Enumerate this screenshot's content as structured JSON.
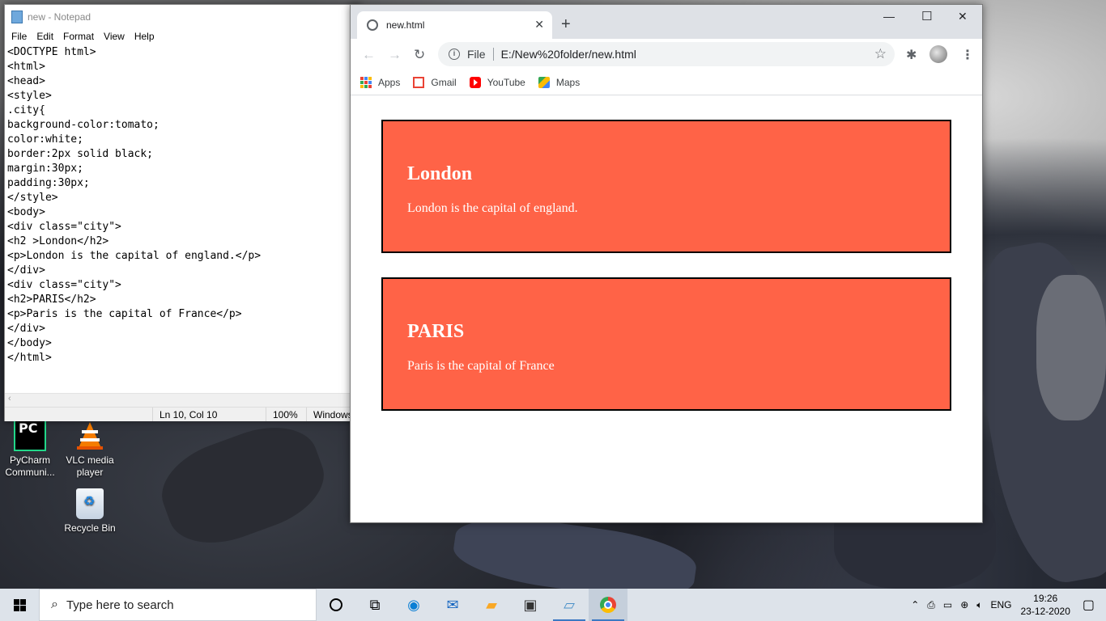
{
  "desktop": {
    "icons": [
      {
        "label": "PyCharm Communi..."
      },
      {
        "label": "VLC media player"
      },
      {
        "label": "Recycle Bin"
      }
    ]
  },
  "notepad": {
    "title": "new - Notepad",
    "menu": [
      "File",
      "Edit",
      "Format",
      "View",
      "Help"
    ],
    "content": "<DOCTYPE html>\n<html>\n<head>\n<style>\n.city{\nbackground-color:tomato;\ncolor:white;\nborder:2px solid black;\nmargin:30px;\npadding:30px;\n</style>\n<body>\n<div class=\"city\">\n<h2 >London</h2>\n<p>London is the capital of england.</p>\n</div>\n<div class=\"city\">\n<h2>PARIS</h2>\n<p>Paris is the capital of France</p>\n</div>\n</body>\n</html>",
    "status": {
      "position": "Ln 10, Col 10",
      "zoom": "100%",
      "eol": "Windows"
    }
  },
  "chrome": {
    "tab_title": "new.html",
    "address_scheme": "File",
    "address_url": "E:/New%20folder/new.html",
    "bookmarks": [
      "Apps",
      "Gmail",
      "YouTube",
      "Maps"
    ],
    "page": {
      "cities": [
        {
          "heading": "London",
          "text": "London is the capital of england."
        },
        {
          "heading": "PARIS",
          "text": "Paris is the capital of France"
        }
      ],
      "city_bg": "#ff6347"
    }
  },
  "taskbar": {
    "search_placeholder": "Type here to search",
    "language": "ENG",
    "time": "19:26",
    "date": "23-12-2020"
  }
}
